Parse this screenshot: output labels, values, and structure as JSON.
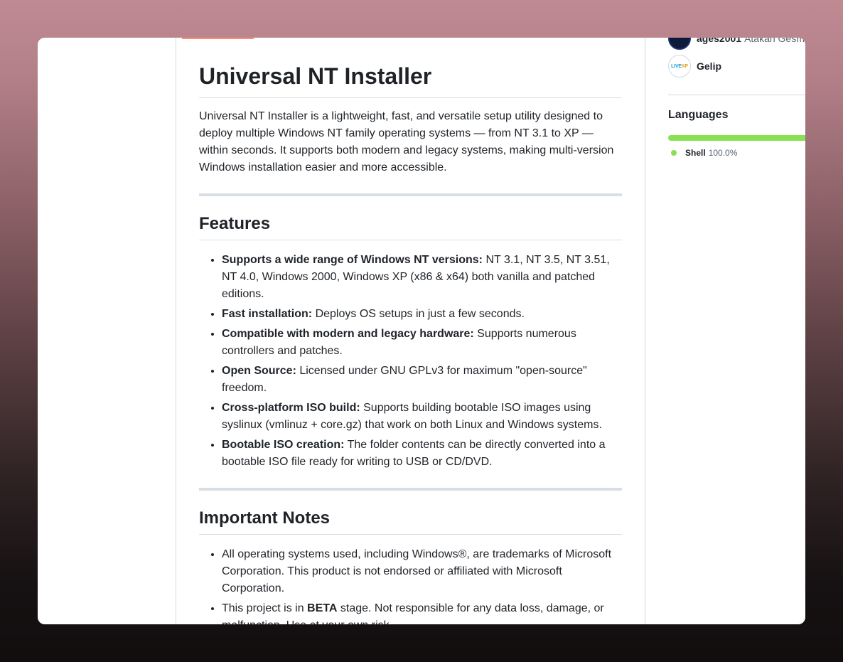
{
  "readme": {
    "title": "Universal NT Installer",
    "intro": "Universal NT Installer is a lightweight, fast, and versatile setup utility designed to deploy multiple Windows NT family operating systems — from NT 3.1 to XP — within seconds. It supports both modern and legacy systems, making multi-version Windows installation easier and more accessible.",
    "features_heading": "Features",
    "features": [
      {
        "bold": "Supports a wide range of Windows NT versions:",
        "text": " NT 3.1, NT 3.5, NT 3.51, NT 4.0, Windows 2000, Windows XP (x86 & x64) both vanilla and patched editions."
      },
      {
        "bold": "Fast installation:",
        "text": " Deploys OS setups in just a few seconds."
      },
      {
        "bold": "Compatible with modern and legacy hardware:",
        "text": " Supports numerous controllers and patches."
      },
      {
        "bold": "Open Source:",
        "text": " Licensed under GNU GPLv3 for maximum \"open-source\" freedom."
      },
      {
        "bold": "Cross-platform ISO build:",
        "text": " Supports building bootable ISO images using syslinux (vmlinuz + core.gz) that work on both Linux and Windows systems."
      },
      {
        "bold": "Bootable ISO creation:",
        "text": " The folder contents can be directly converted into a bootable ISO file ready for writing to USB or CD/DVD."
      }
    ],
    "notes_heading": "Important Notes",
    "notes": [
      {
        "pre": "All operating systems used, including Windows®, are trademarks of Microsoft Corporation. This product is not endorsed or affiliated with Microsoft Corporation.",
        "bold": "",
        "post": ""
      },
      {
        "pre": "This project is in ",
        "bold": "BETA",
        "post": " stage. Not responsible for any data loss, damage, or malfunction. Use at your own risk."
      }
    ]
  },
  "sidebar": {
    "contributors": [
      {
        "login": "ages2001",
        "name": "Atakan Gesme"
      },
      {
        "login": "Gelip",
        "name": "",
        "avatar_text_a": "LIVE",
        "avatar_text_b": "XP"
      }
    ],
    "languages_title": "Languages",
    "languages": [
      {
        "name": "Shell",
        "percent": "100.0%",
        "share": 100.0,
        "color": "#89e051"
      }
    ]
  }
}
